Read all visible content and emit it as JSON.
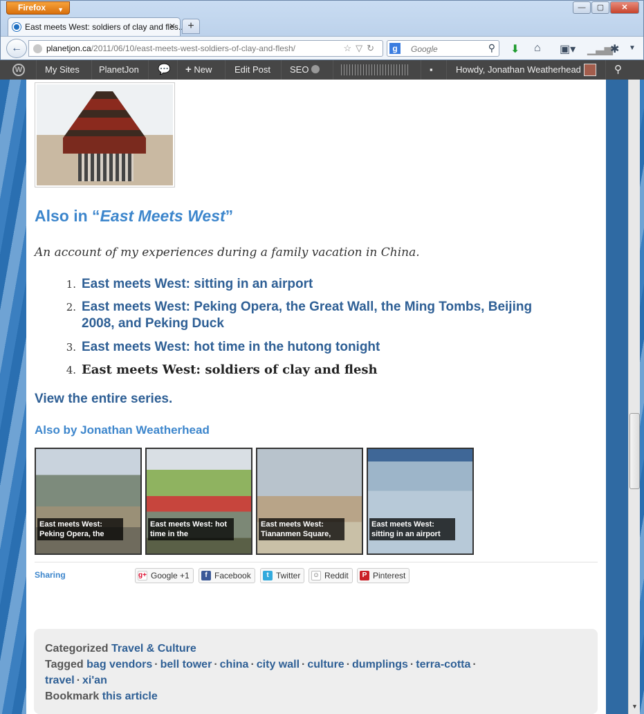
{
  "browser": {
    "menu_button": "Firefox",
    "tab_title": "East meets West: soldiers of clay and fles...",
    "url_host": "planetjon.ca",
    "url_path": "/2011/06/10/east-meets-west-soldiers-of-clay-and-flesh/",
    "search_placeholder": "Google"
  },
  "adminbar": {
    "my_sites": "My Sites",
    "site_name": "PlanetJon",
    "new_label": "New",
    "edit_post": "Edit Post",
    "seo": "SEO",
    "howdy": "Howdy, Jonathan Weatherhead"
  },
  "series": {
    "heading_prefix": "Also in “",
    "heading_name": "East Meets West",
    "heading_suffix": "”",
    "description": "An account of my experiences during a family vacation in China.",
    "items": [
      {
        "num": "1.",
        "title": "East meets West: sitting in an airport"
      },
      {
        "num": "2.",
        "title": "East meets West: Peking Opera, the Great Wall, the Ming Tombs, Beijing 2008, and Peking Duck"
      },
      {
        "num": "3.",
        "title": "East meets West: hot time in the hutong tonight"
      },
      {
        "num": "4.",
        "title": "East meets West: soldiers of clay and flesh"
      }
    ],
    "view_all": "View the entire series."
  },
  "also_by": {
    "heading": "Also by Jonathan Weatherhead",
    "thumbs": [
      {
        "caption": "East meets West: Peking Opera, the"
      },
      {
        "caption": "East meets West: hot time in the"
      },
      {
        "caption": "East meets West: Tiananmen Square,"
      },
      {
        "caption": "East meets West: sitting in an airport"
      }
    ]
  },
  "sharing": {
    "label": "Sharing",
    "buttons": [
      "Google +1",
      "Facebook",
      "Twitter",
      "Reddit",
      "Pinterest"
    ]
  },
  "meta": {
    "categorized_label": "Categorized",
    "category": "Travel & Culture",
    "tagged_label": "Tagged",
    "tags": [
      "bag vendors",
      "bell tower",
      "china",
      "city wall",
      "culture",
      "dumplings",
      "terra-cotta",
      "travel",
      "xi'an"
    ],
    "bookmark_label": "Bookmark",
    "bookmark_link": "this article"
  }
}
